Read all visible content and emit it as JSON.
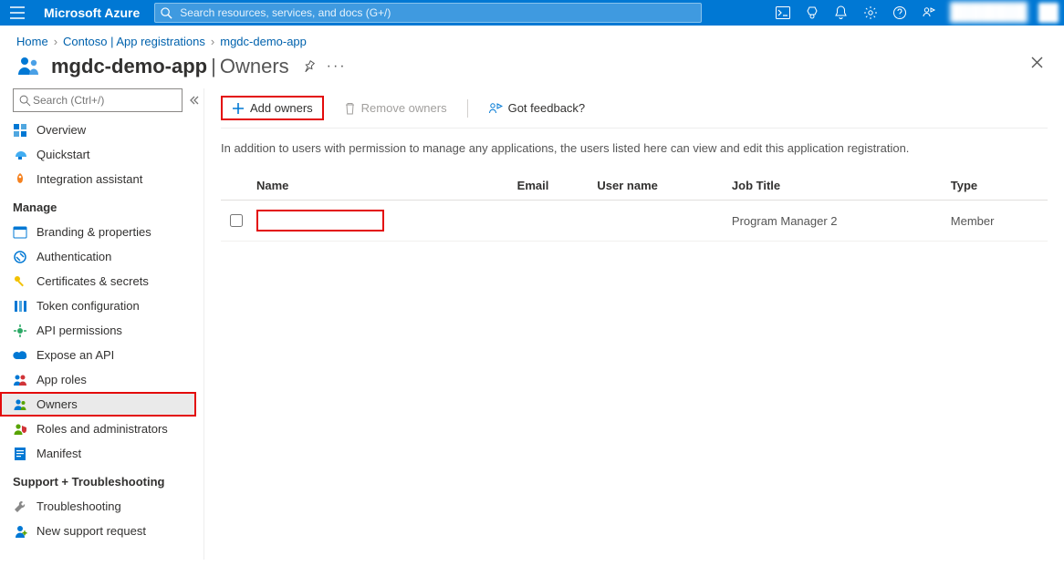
{
  "topbar": {
    "brand": "Microsoft Azure",
    "search_placeholder": "Search resources, services, and docs (G+/)",
    "account_name": "████████████",
    "account_tenant": "████████████"
  },
  "breadcrumb": {
    "items": [
      "Home",
      "Contoso | App registrations",
      "mgdc-demo-app"
    ]
  },
  "page": {
    "title_bold": "mgdc-demo-app",
    "title_sep": " | ",
    "title_light": "Owners"
  },
  "sidebar": {
    "search_placeholder": "Search (Ctrl+/)",
    "top_items": [
      {
        "label": "Overview",
        "icon": "overview"
      },
      {
        "label": "Quickstart",
        "icon": "quickstart"
      },
      {
        "label": "Integration assistant",
        "icon": "rocket"
      }
    ],
    "manage_header": "Manage",
    "manage_items": [
      {
        "label": "Branding & properties",
        "icon": "branding"
      },
      {
        "label": "Authentication",
        "icon": "auth"
      },
      {
        "label": "Certificates & secrets",
        "icon": "key"
      },
      {
        "label": "Token configuration",
        "icon": "token"
      },
      {
        "label": "API permissions",
        "icon": "api"
      },
      {
        "label": "Expose an API",
        "icon": "expose"
      },
      {
        "label": "App roles",
        "icon": "roles"
      },
      {
        "label": "Owners",
        "icon": "owners",
        "selected": true
      },
      {
        "label": "Roles and administrators",
        "icon": "rolesadmin"
      },
      {
        "label": "Manifest",
        "icon": "manifest"
      }
    ],
    "support_header": "Support + Troubleshooting",
    "support_items": [
      {
        "label": "Troubleshooting",
        "icon": "wrench"
      },
      {
        "label": "New support request",
        "icon": "support"
      }
    ]
  },
  "toolbar": {
    "add": "Add owners",
    "remove": "Remove owners",
    "feedback": "Got feedback?"
  },
  "content": {
    "description": "In addition to users with permission to manage any applications, the users listed here can view and edit this application registration.",
    "columns": [
      "Name",
      "Email",
      "User name",
      "Job Title",
      "Type"
    ],
    "rows": [
      {
        "name": "",
        "email": "",
        "username": "",
        "jobtitle": "Program Manager 2",
        "type": "Member"
      }
    ]
  }
}
